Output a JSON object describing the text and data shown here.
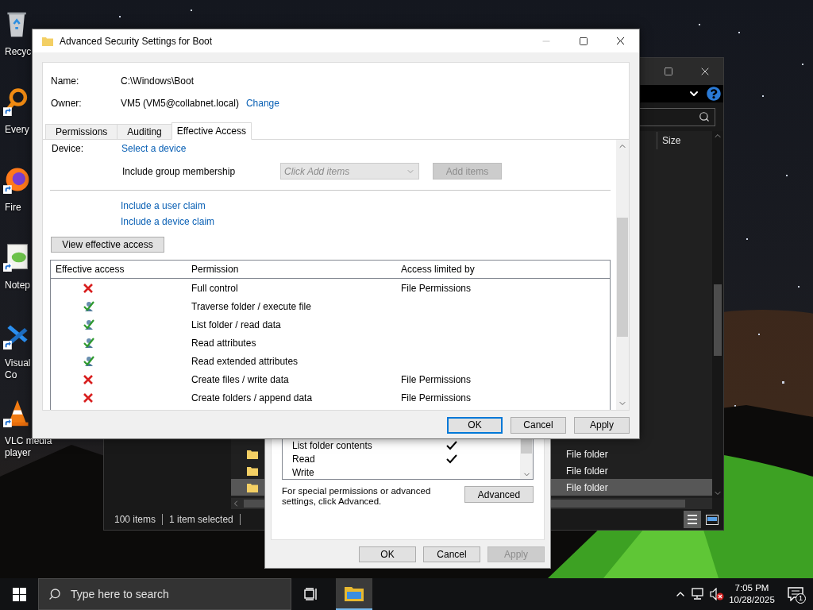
{
  "desktop": {
    "icons": [
      {
        "label": "Recyc"
      },
      {
        "label": "Every"
      },
      {
        "label": "Fire"
      },
      {
        "label": "Notep"
      },
      {
        "label": "Visual\nCo"
      },
      {
        "label": "VLC media\nplayer"
      }
    ]
  },
  "explorer_window": {
    "columns": [
      "Size"
    ],
    "rows": [
      {
        "type": "File folder",
        "selected": false
      },
      {
        "type": "File folder",
        "selected": false
      },
      {
        "type": "File folder",
        "selected": true
      }
    ],
    "status_bar": {
      "item_count": "100 items",
      "selection": "1 item selected"
    },
    "view_modes": [
      {
        "kind": "details",
        "selected": true
      },
      {
        "kind": "tiles",
        "selected": false
      }
    ]
  },
  "properties_dialog": {
    "permissions": [
      {
        "name": "List folder contents",
        "allowed": true
      },
      {
        "name": "Read",
        "allowed": true
      },
      {
        "name": "Write",
        "allowed": false
      }
    ],
    "hint": "For special permissions or advanced settings, click Advanced.",
    "advanced_button": "Advanced",
    "buttons": [
      {
        "label": "OK",
        "disabled": false
      },
      {
        "label": "Cancel",
        "disabled": false
      },
      {
        "label": "Apply",
        "disabled": true
      }
    ]
  },
  "security_dialog": {
    "title": "Advanced Security Settings for Boot",
    "name_label": "Name:",
    "name_value": "C:\\Windows\\Boot",
    "owner_label": "Owner:",
    "owner_value": "VM5 (VM5@collabnet.local)",
    "change_link": "Change",
    "tabs": [
      {
        "label": "Permissions",
        "selected": false
      },
      {
        "label": "Auditing",
        "selected": false
      },
      {
        "label": "Effective Access",
        "selected": true
      }
    ],
    "device_label": "Device:",
    "device_link": "Select a device",
    "group_label": "Include group membership",
    "group_select": {
      "placeholder": "Click Add items",
      "disabled": true
    },
    "add_button": {
      "label": "Add items",
      "disabled": true
    },
    "claim_links": [
      "Include a user claim",
      "Include a device claim"
    ],
    "view_button": "View effective access",
    "table": {
      "columns": [
        "Effective access",
        "Permission",
        "Access limited by"
      ],
      "rows": [
        {
          "allowed": false,
          "permission": "Full control",
          "limited_by": "File Permissions"
        },
        {
          "allowed": true,
          "permission": "Traverse folder / execute file"
        },
        {
          "allowed": true,
          "permission": "List folder / read data"
        },
        {
          "allowed": true,
          "permission": "Read attributes"
        },
        {
          "allowed": true,
          "permission": "Read extended attributes"
        },
        {
          "allowed": false,
          "permission": "Create files / write data",
          "limited_by": "File Permissions"
        },
        {
          "allowed": false,
          "permission": "Create folders / append data",
          "limited_by": "File Permissions"
        }
      ]
    },
    "buttons": [
      {
        "label": "OK",
        "default": true
      },
      {
        "label": "Cancel",
        "default": false
      },
      {
        "label": "Apply",
        "default": false
      }
    ]
  },
  "taskbar": {
    "search_placeholder": "Type here to search",
    "explorer_active": true,
    "volume_muted": true,
    "time": "7:05 PM",
    "date": "10/28/2025",
    "notification_count": "1"
  }
}
